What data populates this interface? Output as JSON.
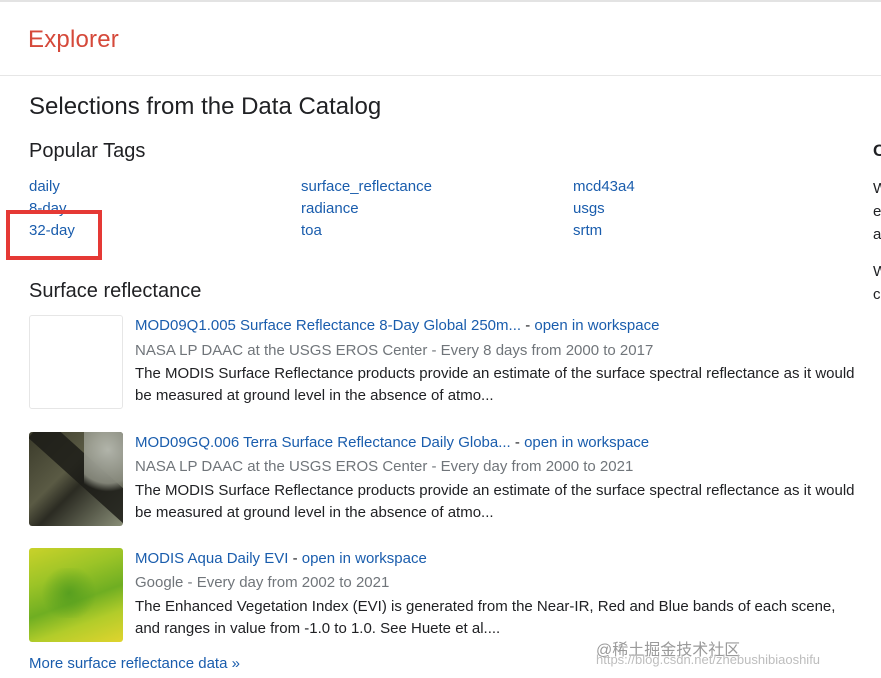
{
  "header": {
    "app_title": "Explorer"
  },
  "page": {
    "title": "Selections from the Data Catalog"
  },
  "popular_tags": {
    "heading": "Popular Tags",
    "columns": [
      [
        "daily",
        "8-day",
        "32-day"
      ],
      [
        "surface_reflectance",
        "radiance",
        "toa"
      ],
      [
        "mcd43a4",
        "usgs",
        "srtm"
      ]
    ]
  },
  "surface_reflectance": {
    "heading": "Surface reflectance",
    "datasets": [
      {
        "title": "MOD09Q1.005 Surface Reflectance 8-Day Global 250m...",
        "separator": " - ",
        "open_label": "open in workspace",
        "meta": "NASA LP DAAC at the USGS EROS Center - Every 8 days from 2000 to 2017",
        "description": "The MODIS Surface Reflectance products provide an estimate of the surface spectral reflectance as it would be measured at ground level in the absence of atmo..."
      },
      {
        "title": "MOD09GQ.006 Terra Surface Reflectance Daily Globa...",
        "separator": " - ",
        "open_label": "open in workspace",
        "meta": "NASA LP DAAC at the USGS EROS Center - Every day from 2000 to 2021",
        "description": "The MODIS Surface Reflectance products provide an estimate of the surface spectral reflectance as it would be measured at ground level in the absence of atmo..."
      },
      {
        "title": "MODIS Aqua Daily EVI",
        "separator": " - ",
        "open_label": "open in workspace",
        "meta": "Google - Every day from 2002 to 2021",
        "description": "The Enhanced Vegetation Index (EVI) is generated from the Near-IR, Red and Blue bands of each scene, and ranges in value from -1.0 to 1.0. See Huete et al...."
      }
    ],
    "more_link": "More surface reflectance data »"
  },
  "right_column_fragments": [
    "C",
    "W",
    "e",
    "a",
    "W",
    "c"
  ],
  "watermark": {
    "line1": "@稀土掘金技术社区",
    "line2": "https://blog.csdn.net/zhebushibiaoshifu"
  },
  "colors": {
    "brand": "#d5493a",
    "link": "#1a5dad",
    "highlight": "#e53935",
    "meta": "#70757a"
  }
}
